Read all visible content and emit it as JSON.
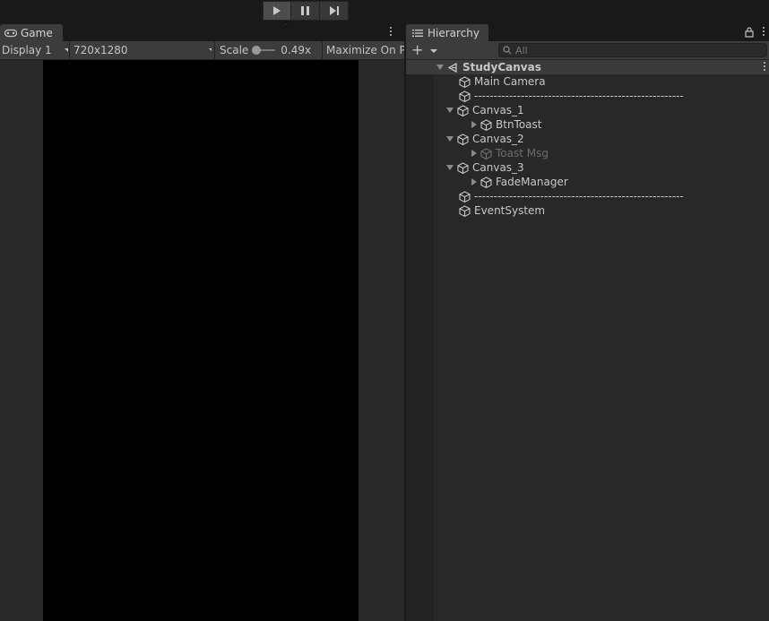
{
  "toolbar": {
    "play_icon": "play-icon",
    "pause_icon": "pause-icon",
    "step_icon": "step-icon"
  },
  "game": {
    "tab_label": "Game",
    "display": "Display 1",
    "resolution": "720x1280",
    "scale_label": "Scale",
    "scale_value": "0.49x",
    "maximize_label": "Maximize On Pl"
  },
  "hierarchy": {
    "tab_label": "Hierarchy",
    "search_placeholder": "All",
    "scene_name": "StudyCanvas",
    "items": [
      {
        "label": "Main Camera",
        "depth": 0,
        "fold": "none",
        "dim": false
      },
      {
        "label": "------------------------------------------------------",
        "depth": 0,
        "fold": "none",
        "dim": false
      },
      {
        "label": "Canvas_1",
        "depth": 0,
        "fold": "open",
        "dim": false
      },
      {
        "label": "BtnToast",
        "depth": 1,
        "fold": "closed",
        "dim": false
      },
      {
        "label": "Canvas_2",
        "depth": 0,
        "fold": "open",
        "dim": false
      },
      {
        "label": "Toast Msg",
        "depth": 1,
        "fold": "closed",
        "dim": true
      },
      {
        "label": "Canvas_3",
        "depth": 0,
        "fold": "open",
        "dim": false
      },
      {
        "label": "FadeManager",
        "depth": 1,
        "fold": "closed",
        "dim": false
      },
      {
        "label": "------------------------------------------------------",
        "depth": 0,
        "fold": "none",
        "dim": false
      },
      {
        "label": "EventSystem",
        "depth": 0,
        "fold": "none",
        "dim": false
      }
    ]
  }
}
